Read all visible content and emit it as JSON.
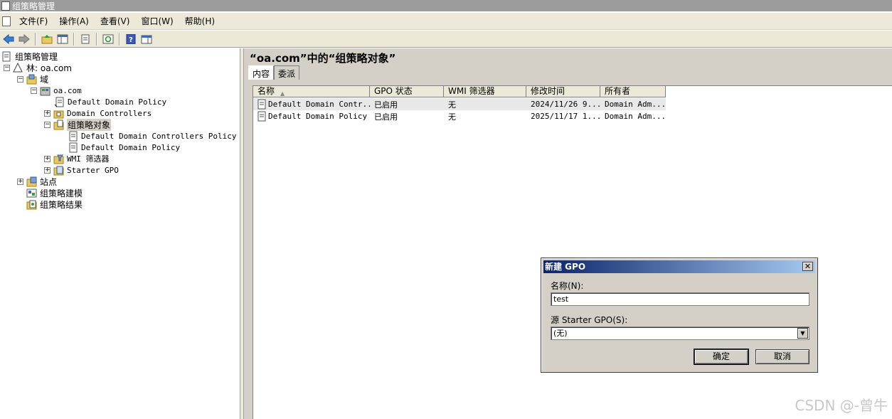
{
  "window": {
    "title": "组策略管理"
  },
  "menu": [
    "文件(F)",
    "操作(A)",
    "查看(V)",
    "窗口(W)",
    "帮助(H)"
  ],
  "toolbar": {
    "icons": [
      "back-arrow-icon",
      "forward-arrow-icon",
      "up-folder-icon",
      "show-hide-tree-icon",
      "properties-icon",
      "refresh-icon",
      "help-icon",
      "show-action-pane-icon"
    ]
  },
  "tree": {
    "root": "组策略管理",
    "forest": "林: oa.com",
    "domains": "域",
    "domain": "oa.com",
    "default_policy": "Default Domain Policy",
    "domain_controllers": "Domain Controllers",
    "gpo_container": "组策略对象",
    "gpo1": "Default Domain Controllers Policy",
    "gpo2": "Default Domain Policy",
    "wmi": "WMI 筛选器",
    "starter": "Starter GPO",
    "sites": "站点",
    "modeling": "组策略建模",
    "results": "组策略结果"
  },
  "right": {
    "title": "“oa.com”中的“组策略对象”",
    "tabs": [
      "内容",
      "委派"
    ],
    "columns": [
      "名称",
      "GPO 状态",
      "WMI 筛选器",
      "修改时间",
      "所有者"
    ],
    "rows": [
      [
        "Default Domain Contr...",
        "已启用",
        "无",
        "2024/11/26 9...",
        "Domain Adm..."
      ],
      [
        "Default Domain Policy",
        "已启用",
        "无",
        "2025/11/17 1...",
        "Domain Adm..."
      ]
    ]
  },
  "dialog": {
    "title": "新建 GPO",
    "name_label": "名称(N):",
    "name_value": "test",
    "source_label": "源 Starter GPO(S):",
    "source_value": "(无)",
    "ok": "确定",
    "cancel": "取消"
  },
  "watermark": "CSDN @-曾牛"
}
